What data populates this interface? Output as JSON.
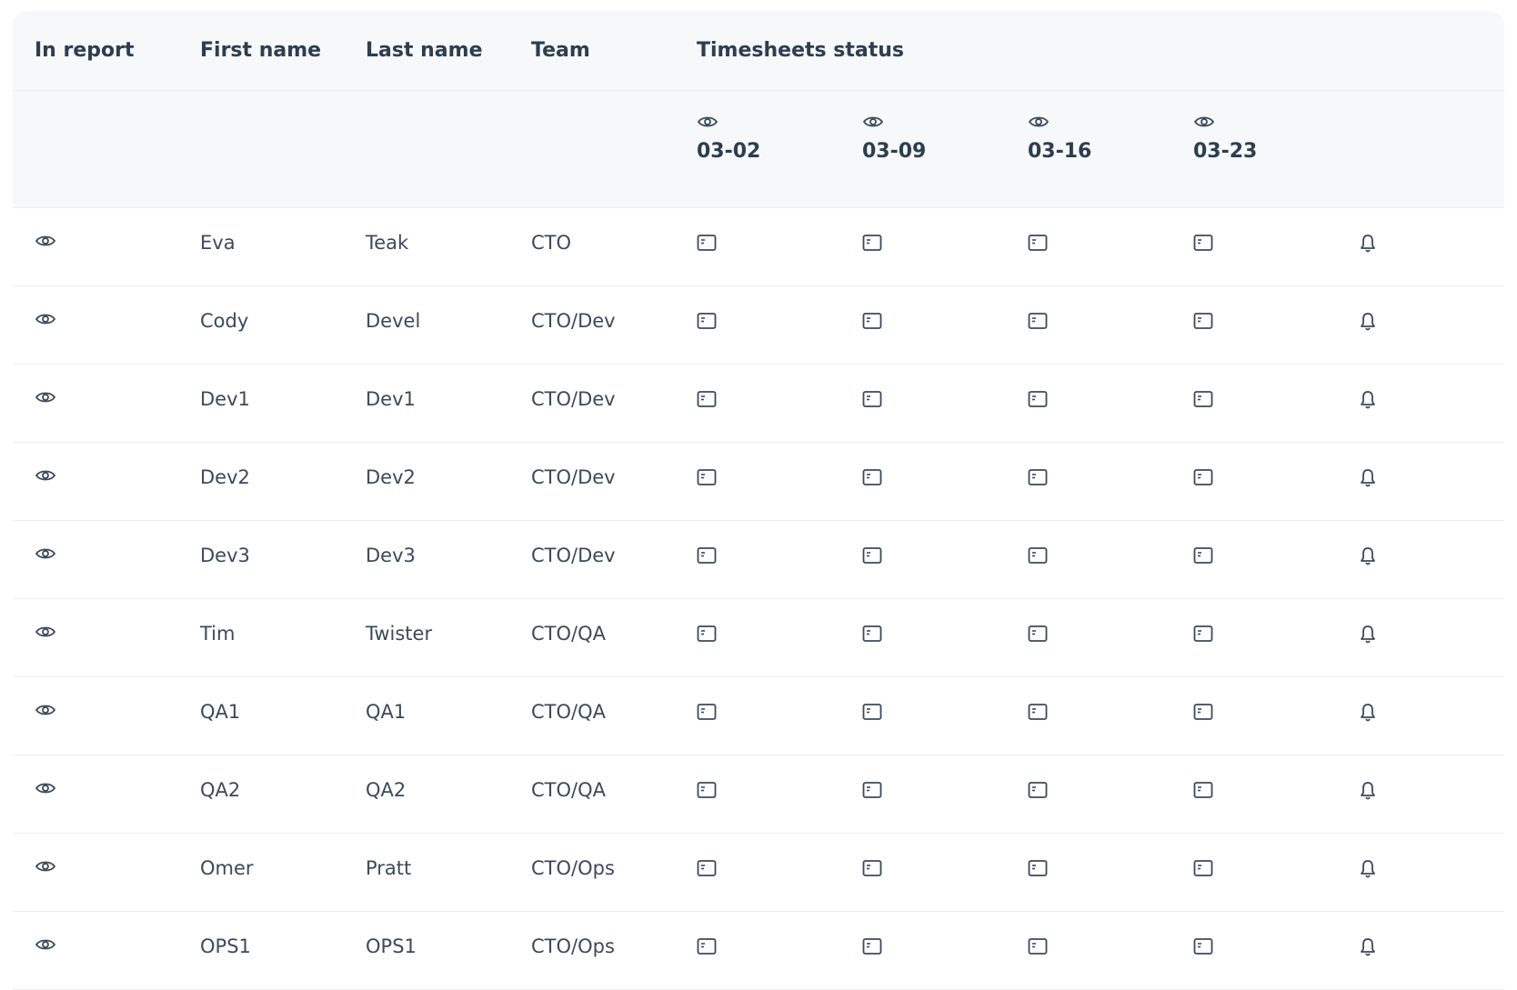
{
  "columns": {
    "in_report": "In report",
    "first_name": "First name",
    "last_name": "Last name",
    "team": "Team",
    "timesheets_status": "Timesheets status"
  },
  "weeks": [
    "03-02",
    "03-09",
    "03-16",
    "03-23"
  ],
  "icons": {
    "report": "eye-icon",
    "timesheet": "timesheet-icon",
    "notify": "bell-icon"
  },
  "rows": [
    {
      "first": "Eva",
      "last": "Teak",
      "team": "CTO"
    },
    {
      "first": "Cody",
      "last": "Devel",
      "team": "CTO/Dev"
    },
    {
      "first": "Dev1",
      "last": "Dev1",
      "team": "CTO/Dev"
    },
    {
      "first": "Dev2",
      "last": "Dev2",
      "team": "CTO/Dev"
    },
    {
      "first": "Dev3",
      "last": "Dev3",
      "team": "CTO/Dev"
    },
    {
      "first": "Tim",
      "last": "Twister",
      "team": "CTO/QA"
    },
    {
      "first": "QA1",
      "last": "QA1",
      "team": "CTO/QA"
    },
    {
      "first": "QA2",
      "last": "QA2",
      "team": "CTO/QA"
    },
    {
      "first": "Omer",
      "last": "Pratt",
      "team": "CTO/Ops"
    },
    {
      "first": "OPS1",
      "last": "OPS1",
      "team": "CTO/Ops"
    }
  ]
}
